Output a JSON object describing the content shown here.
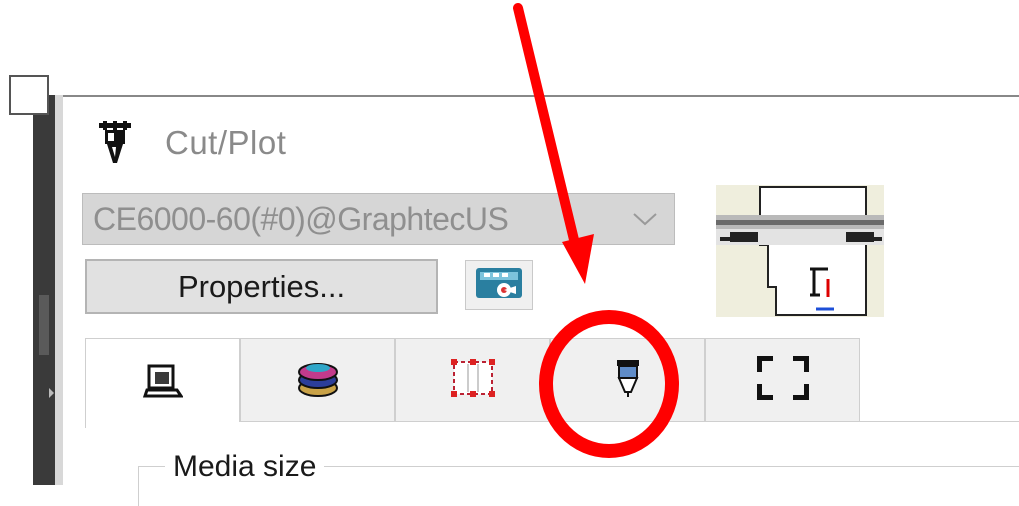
{
  "window": {
    "title": "Cut/Plot",
    "title_icon": "cutter-blade-icon"
  },
  "device": {
    "selected": "CE6000-60(#0)@GraphtecUS"
  },
  "buttons": {
    "properties_label": "Properties...",
    "cutting_master_icon": "cutting-master-icon"
  },
  "tabs": [
    {
      "name": "media-tab",
      "icon": "media-icon",
      "active": true
    },
    {
      "name": "layers-tab",
      "icon": "layers-icon",
      "active": false
    },
    {
      "name": "registration-marks-tab",
      "icon": "registration-marks-icon",
      "active": false
    },
    {
      "name": "cutting-conditions-tab",
      "icon": "pen-blade-icon",
      "active": false
    },
    {
      "name": "area-tab",
      "icon": "area-frame-icon",
      "active": false
    }
  ],
  "media_group": {
    "label": "Media size"
  },
  "annotation": {
    "color": "#ff0000",
    "arrow": "red-arrow",
    "circle": "red-circle"
  }
}
